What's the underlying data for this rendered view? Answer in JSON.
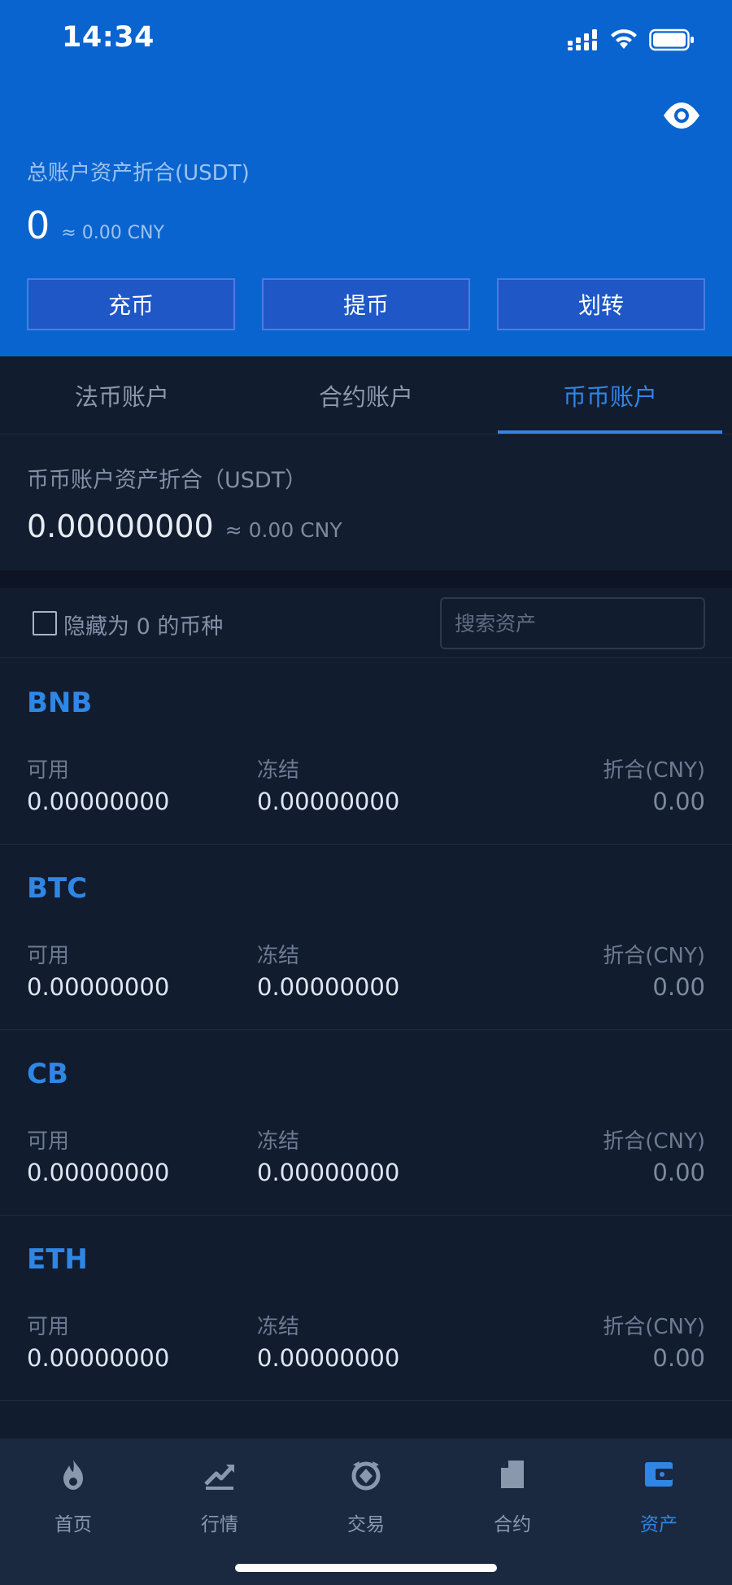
{
  "status_bar": {
    "time": "14:34"
  },
  "header": {
    "total_label": "总账户资产折合(USDT)",
    "total_value": "0",
    "total_cny": "≈ 0.00 CNY",
    "actions": [
      "充币",
      "提币",
      "划转"
    ]
  },
  "tabs": [
    {
      "label": "法币账户",
      "active": false
    },
    {
      "label": "合约账户",
      "active": false
    },
    {
      "label": "币币账户",
      "active": true
    }
  ],
  "account": {
    "label": "币币账户资产折合（USDT）",
    "value": "0.00000000",
    "cny": "≈ 0.00 CNY"
  },
  "filter": {
    "hide_zero_label": "隐藏为 0 的币种",
    "hide_zero_checked": false,
    "search_placeholder": "搜索资产"
  },
  "columns": {
    "available": "可用",
    "frozen": "冻结",
    "cny": "折合(CNY)"
  },
  "assets": [
    {
      "name": "BNB",
      "available": "0.00000000",
      "frozen": "0.00000000",
      "cny": "0.00"
    },
    {
      "name": "BTC",
      "available": "0.00000000",
      "frozen": "0.00000000",
      "cny": "0.00"
    },
    {
      "name": "CB",
      "available": "0.00000000",
      "frozen": "0.00000000",
      "cny": "0.00"
    },
    {
      "name": "ETH",
      "available": "0.00000000",
      "frozen": "0.00000000",
      "cny": "0.00"
    }
  ],
  "nav": [
    {
      "label": "首页",
      "icon": "flame-icon",
      "active": false
    },
    {
      "label": "行情",
      "icon": "chart-icon",
      "active": false
    },
    {
      "label": "交易",
      "icon": "exchange-icon",
      "active": false
    },
    {
      "label": "合约",
      "icon": "contract-icon",
      "active": false
    },
    {
      "label": "资产",
      "icon": "wallet-icon",
      "active": true
    }
  ],
  "colors": {
    "header_blue": "#0a64cf",
    "accent": "#2f86e5",
    "background": "#121c2f",
    "nav_bg": "#1a2840"
  }
}
